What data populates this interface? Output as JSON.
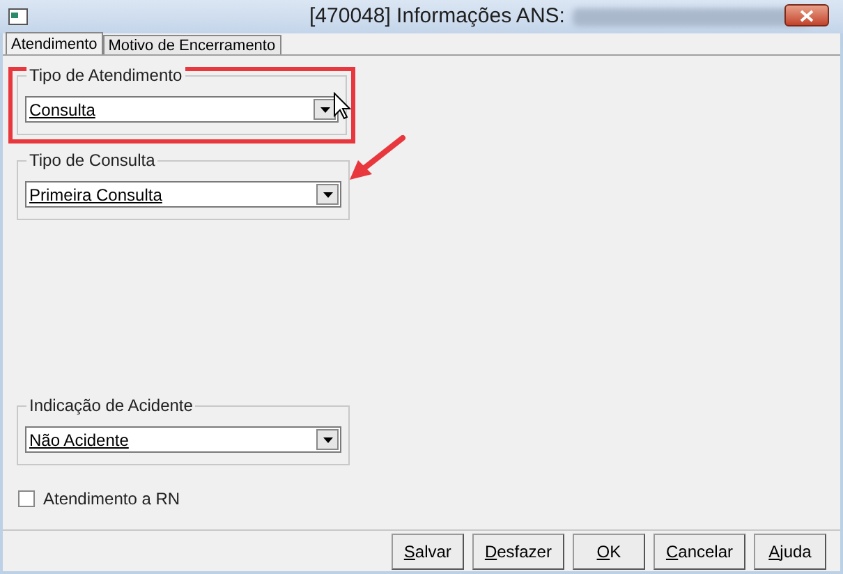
{
  "window": {
    "title": "[470048]  Informações ANS:"
  },
  "tabs": [
    {
      "label": "Atendimento",
      "selected": true
    },
    {
      "label": "Motivo de Encerramento",
      "selected": false
    }
  ],
  "groups": [
    {
      "title": "Tipo de Atendimento",
      "value": "Consulta",
      "highlighted": true
    },
    {
      "title": "Tipo de Consulta",
      "value": "Primeira Consulta",
      "highlighted": false
    },
    {
      "title": "Indicação de Acidente",
      "value": "Não Acidente",
      "highlighted": false
    }
  ],
  "checkbox": {
    "label": "Atendimento a RN",
    "checked": false
  },
  "buttons": [
    {
      "label": "Salvar"
    },
    {
      "label": "Desfazer"
    },
    {
      "label": "OK"
    },
    {
      "label": "Cancelar"
    },
    {
      "label": "Ajuda"
    }
  ]
}
